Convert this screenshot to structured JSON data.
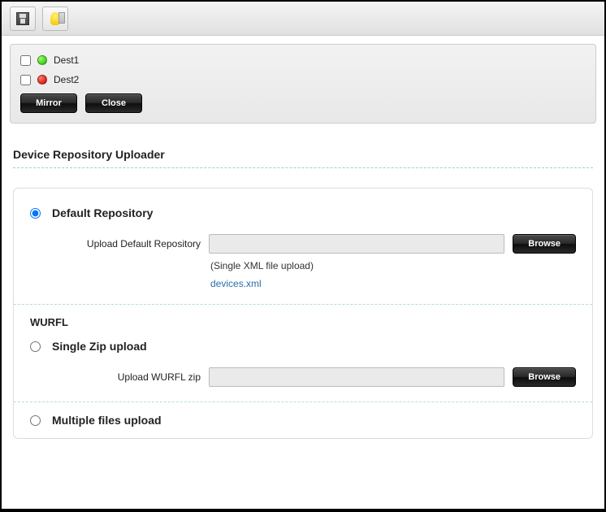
{
  "toolbar": {
    "save_name": "save-icon",
    "hint_name": "bulb-icon"
  },
  "destPanel": {
    "items": [
      {
        "label": "Dest1",
        "status": "green",
        "checked": false
      },
      {
        "label": "Dest2",
        "status": "red",
        "checked": false
      }
    ],
    "mirror_label": "Mirror",
    "close_label": "Close"
  },
  "main_title": "Device Repository Uploader",
  "defaultRepo": {
    "radio_label": "Default Repository",
    "upload_label": "Upload Default Repository",
    "browse_label": "Browse",
    "hint": "(Single XML file upload)",
    "link": "devices.xml"
  },
  "wurfl": {
    "section_label": "WURFL",
    "singleZip": {
      "radio_label": "Single Zip upload",
      "upload_label": "Upload WURFL zip",
      "browse_label": "Browse"
    },
    "multiFiles": {
      "radio_label": "Multiple files upload"
    }
  }
}
